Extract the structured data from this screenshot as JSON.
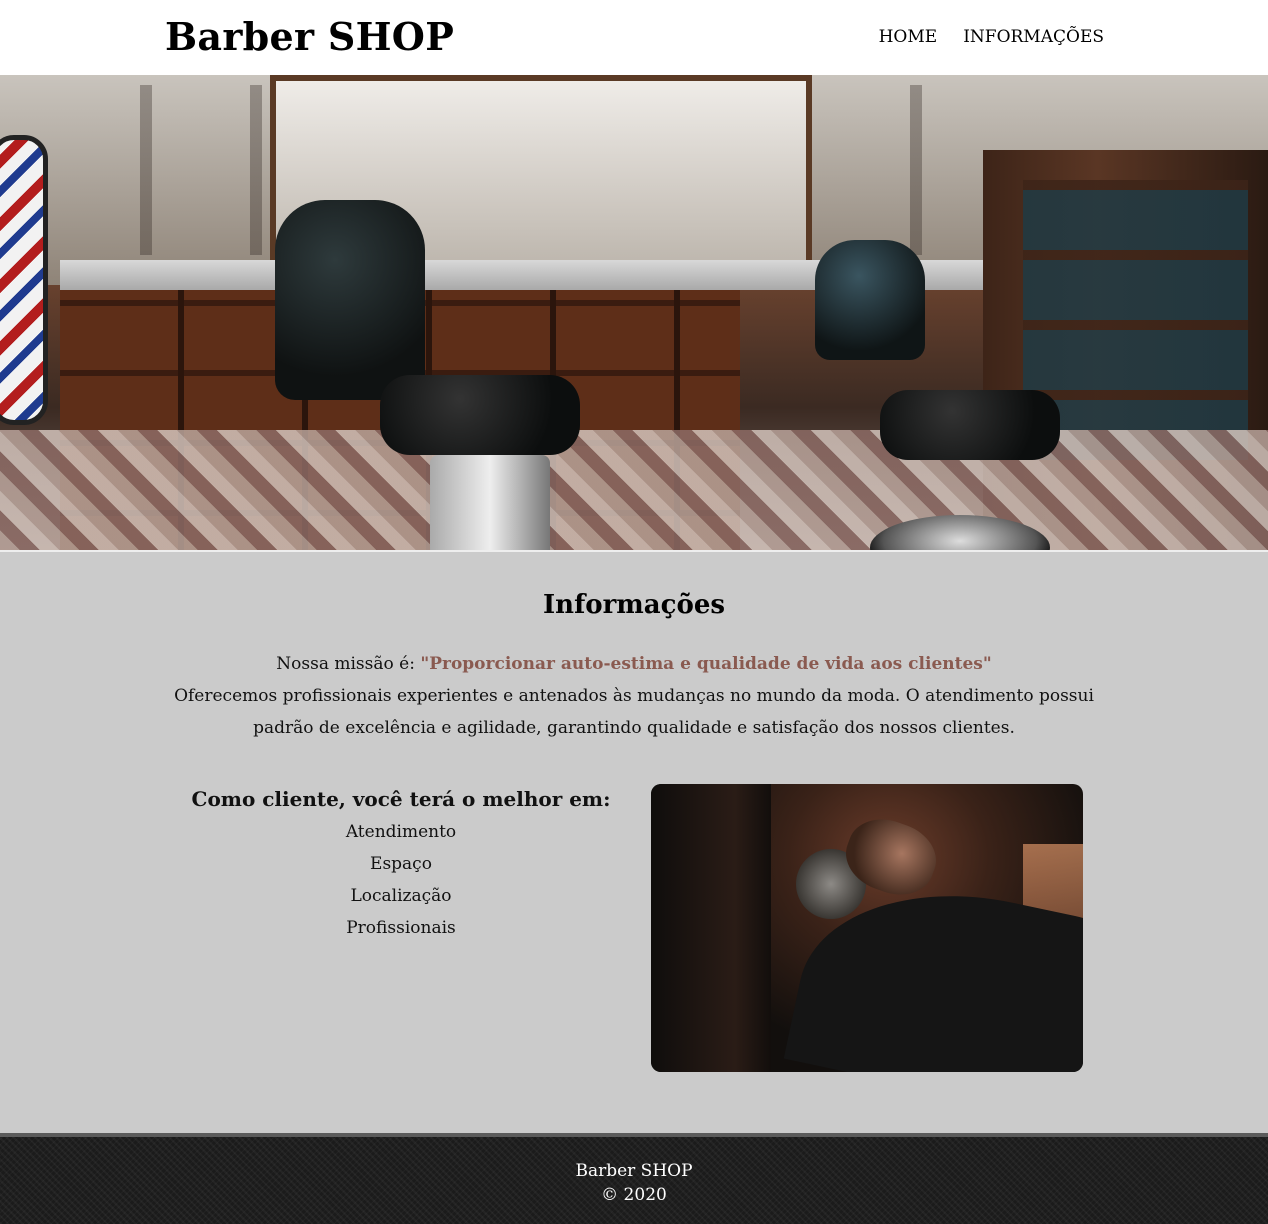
{
  "header": {
    "brand": "Barber SHOP",
    "nav": [
      {
        "label": "HOME"
      },
      {
        "label": "INFORMAÇÕES"
      }
    ]
  },
  "info": {
    "title": "Informações",
    "mission_prefix": "Nossa missão é:",
    "mission_quote": "\"Proporcionar auto-estima e qualidade de vida aos clientes\"",
    "description": "Oferecemos profissionais experientes e antenados às mudanças no mundo da moda. O atendimento possui padrão de excelência e agilidade, garantindo qualidade e satisfação dos nossos clientes.",
    "benefits_title": "Como cliente, você terá o melhor em:",
    "benefits": [
      "Atendimento",
      "Espaço",
      "Localização",
      "Profissionais"
    ]
  },
  "footer": {
    "brand": "Barber SHOP",
    "copyright": "© 2020"
  },
  "colors": {
    "accent_quote": "#8a5a50",
    "content_bg": "#cbcbcb",
    "footer_bg": "#1b1b1b"
  }
}
